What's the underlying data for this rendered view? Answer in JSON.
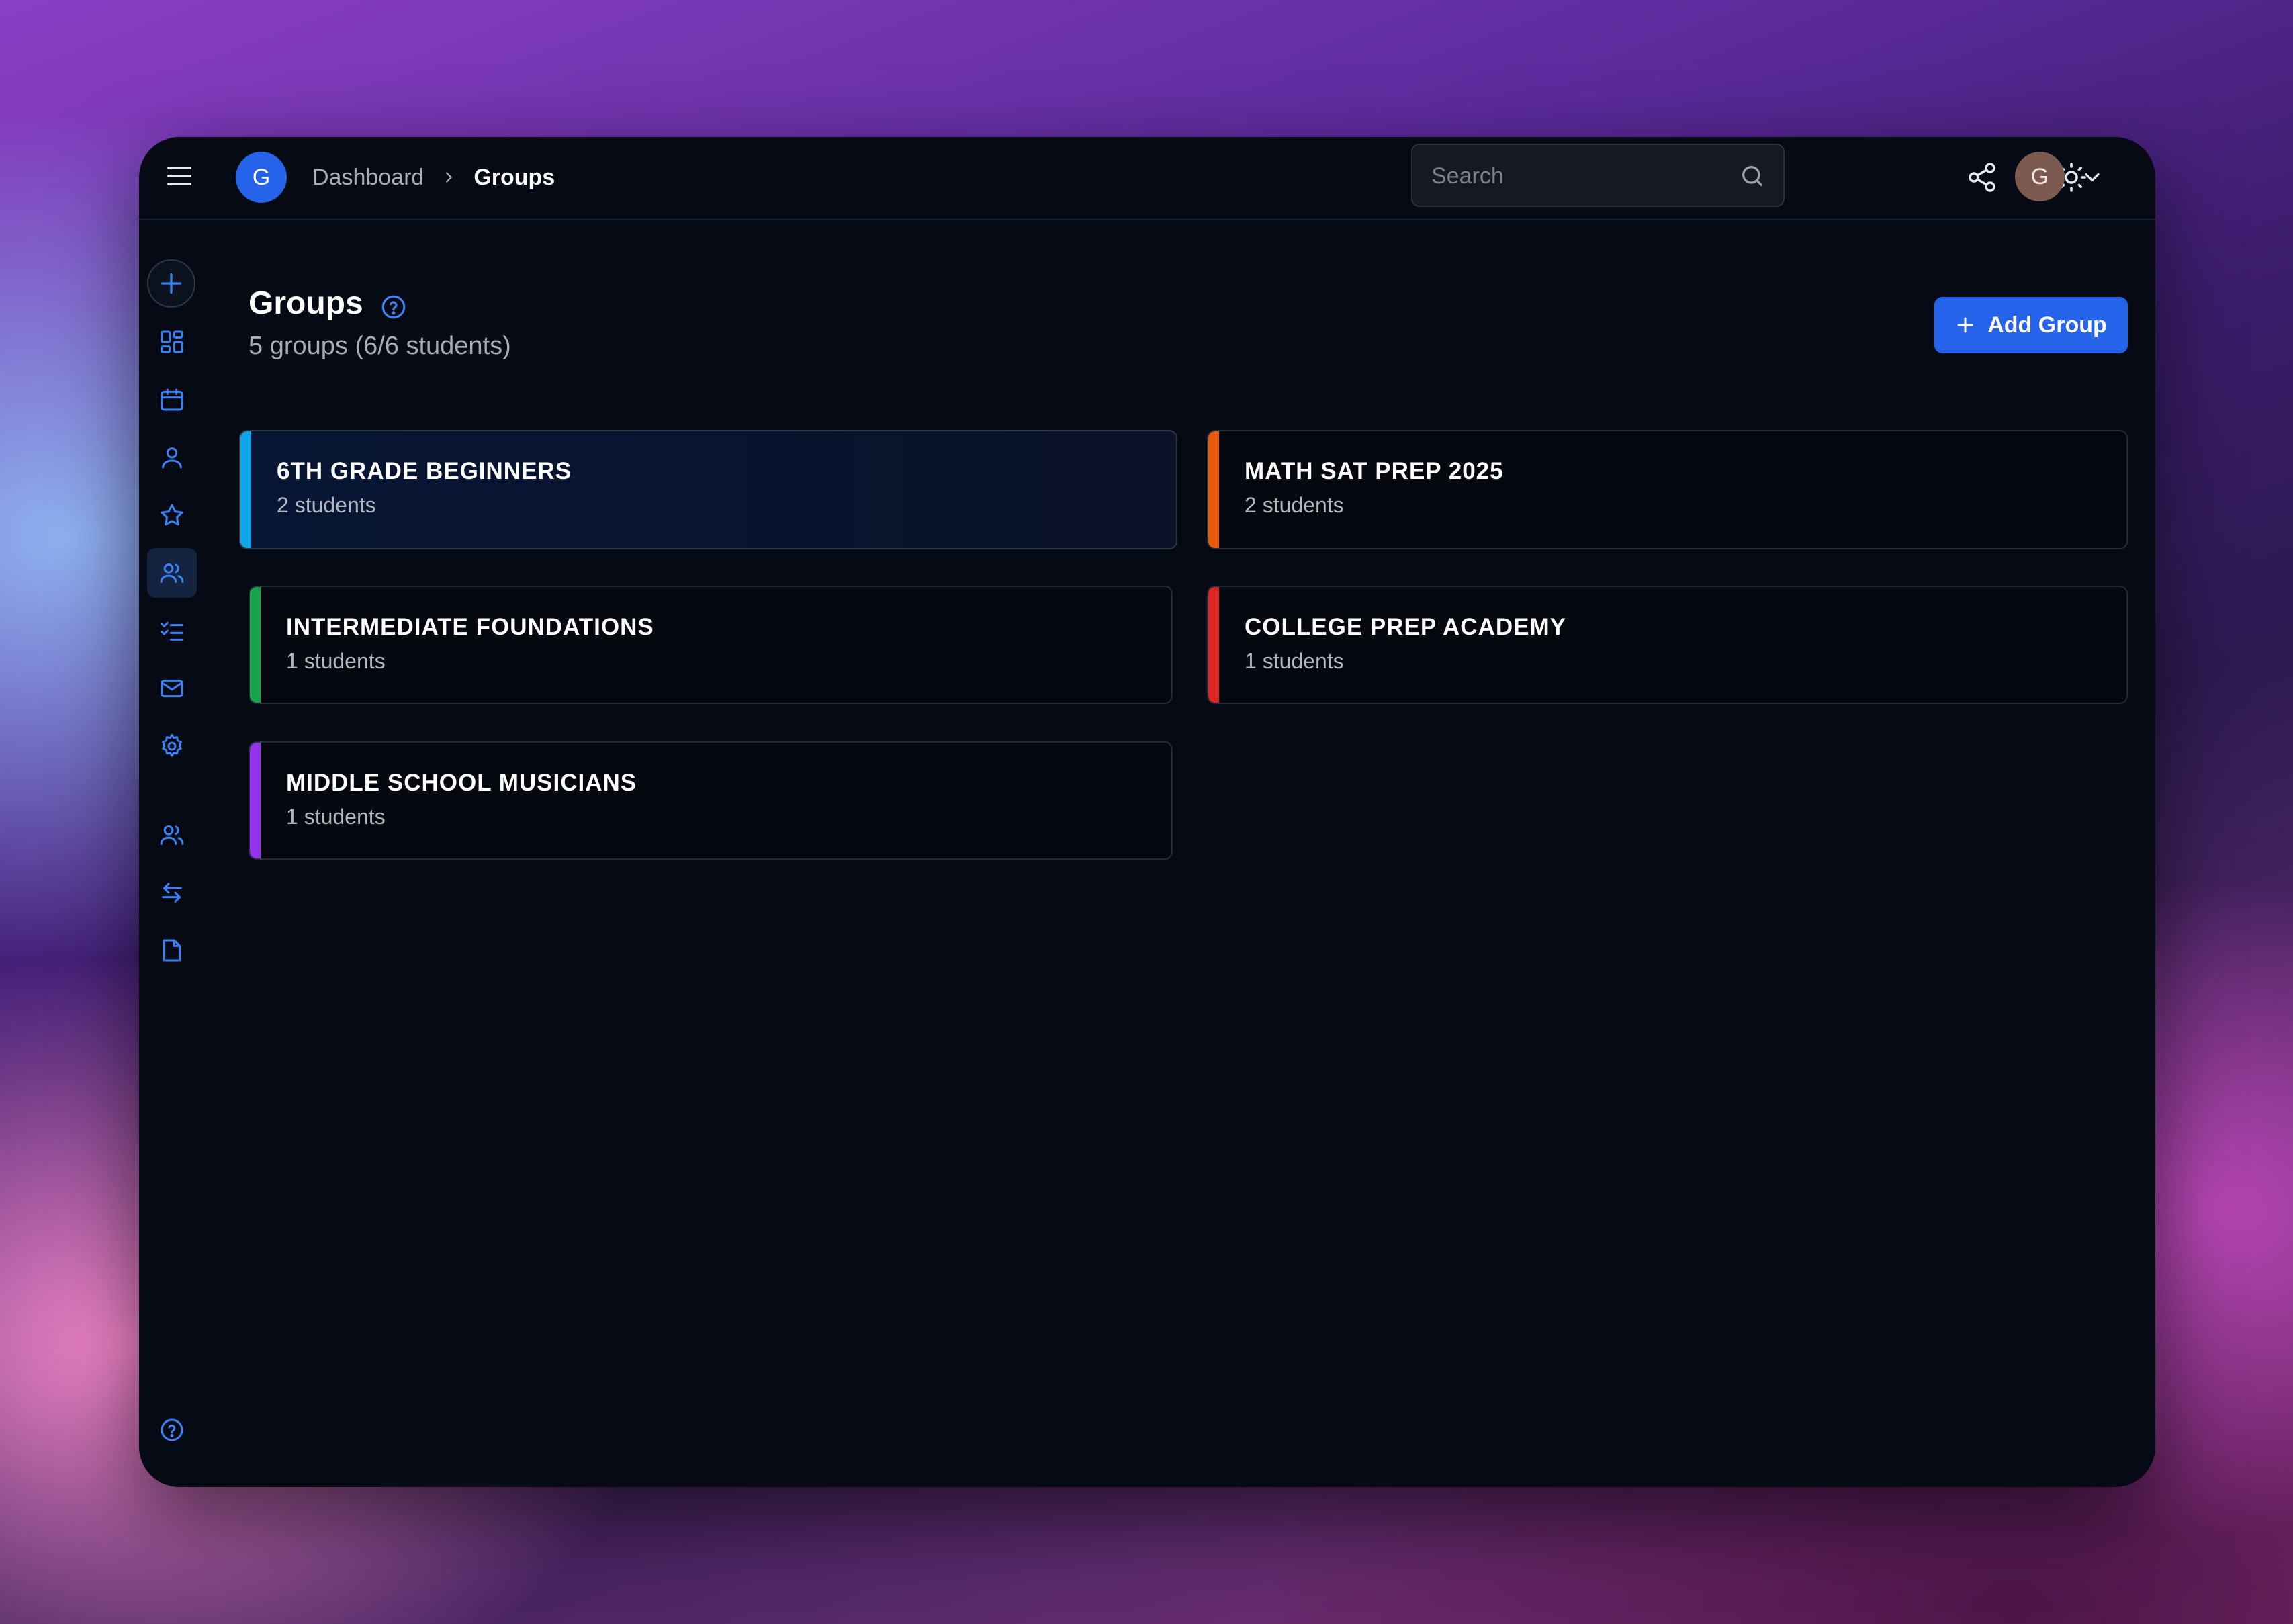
{
  "topbar": {
    "org_initial": "G",
    "breadcrumb": {
      "parent": "Dashboard",
      "current": "Groups"
    },
    "search": {
      "placeholder": "Search"
    },
    "user_initial": "G"
  },
  "sidebar": {
    "items": [
      {
        "name": "dashboard",
        "icon": "grid-icon",
        "active": false
      },
      {
        "name": "calendar",
        "icon": "calendar-icon",
        "active": false
      },
      {
        "name": "students",
        "icon": "user-icon",
        "active": false
      },
      {
        "name": "favorites",
        "icon": "star-icon",
        "active": false
      },
      {
        "name": "groups",
        "icon": "users-icon",
        "active": true
      },
      {
        "name": "tasks",
        "icon": "checklist-icon",
        "active": false
      },
      {
        "name": "messages",
        "icon": "mail-icon",
        "active": false
      },
      {
        "name": "settings",
        "icon": "gear-icon",
        "active": false
      },
      {
        "name": "team",
        "icon": "users-icon",
        "active": false
      },
      {
        "name": "transfers",
        "icon": "swap-icon",
        "active": false
      },
      {
        "name": "documents",
        "icon": "file-icon",
        "active": false
      },
      {
        "name": "help",
        "icon": "help-icon",
        "active": false
      }
    ]
  },
  "main": {
    "title": "Groups",
    "subtitle": "5 groups (6/6 students)",
    "add_button_label": "Add Group",
    "groups": [
      {
        "name": "6TH GRADE BEGINNERS",
        "count": "2 students",
        "color": "#0ea5e9"
      },
      {
        "name": "MATH SAT PREP 2025",
        "count": "2 students",
        "color": "#ea580c"
      },
      {
        "name": "INTERMEDIATE FOUNDATIONS",
        "count": "1 students",
        "color": "#16a34a"
      },
      {
        "name": "COLLEGE PREP ACADEMY",
        "count": "1 students",
        "color": "#dc2626"
      },
      {
        "name": "MIDDLE SCHOOL MUSICIANS",
        "count": "1 students",
        "color": "#9333ea"
      }
    ]
  },
  "colors": {
    "accent": "#2563eb",
    "icon_blue": "#3b82f6",
    "window_bg": "#050a15"
  }
}
